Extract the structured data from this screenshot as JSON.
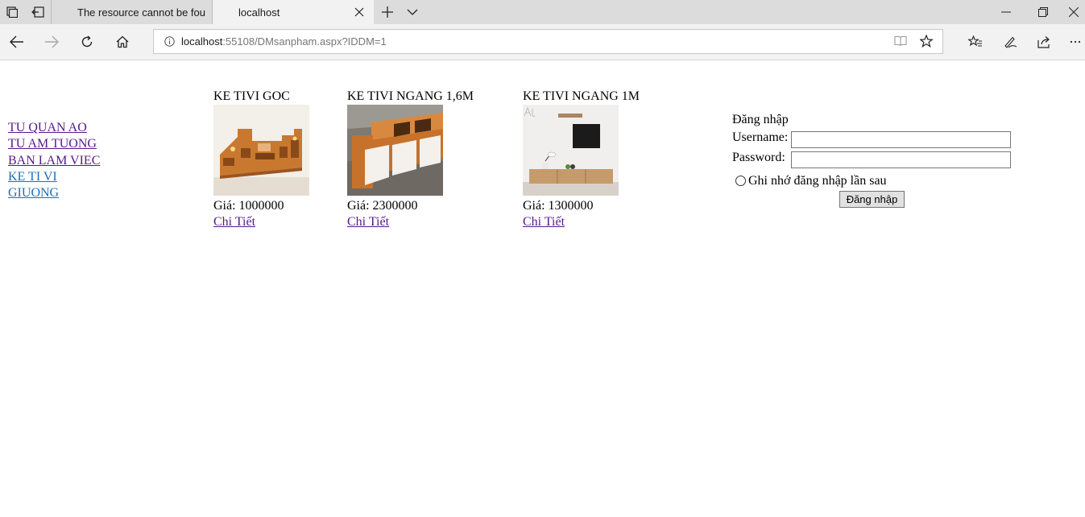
{
  "browser": {
    "tabs": [
      {
        "title": "The resource cannot be fou"
      },
      {
        "title": "localhost"
      }
    ],
    "address": {
      "host": "localhost",
      "path": ":55108/DMsanpham.aspx?IDDM=1"
    }
  },
  "sidebar": {
    "categories": [
      {
        "label": "TU QUAN AO"
      },
      {
        "label": "TU AM TUONG"
      },
      {
        "label": "BAN LAM VIEC"
      },
      {
        "label": "KE TI VI"
      },
      {
        "label": "GIUONG"
      }
    ]
  },
  "products": [
    {
      "name": "KE TIVI GOC",
      "price": "Giá: 1000000",
      "detail": "Chi Tiết"
    },
    {
      "name": "KE TIVI NGANG 1,6M",
      "price": "Giá: 2300000",
      "detail": "Chi Tiết"
    },
    {
      "name": "KE TIVI NGANG 1M",
      "price": "Giá: 1300000",
      "detail": "Chi Tiết"
    }
  ],
  "login": {
    "heading": "Đăng nhập",
    "username_label": "Username:",
    "username_value": "",
    "password_label": "Password:",
    "password_value": "",
    "remember_label": "Ghi nhớ đăng nhập lần sau",
    "submit_label": "Đăng nhập"
  }
}
